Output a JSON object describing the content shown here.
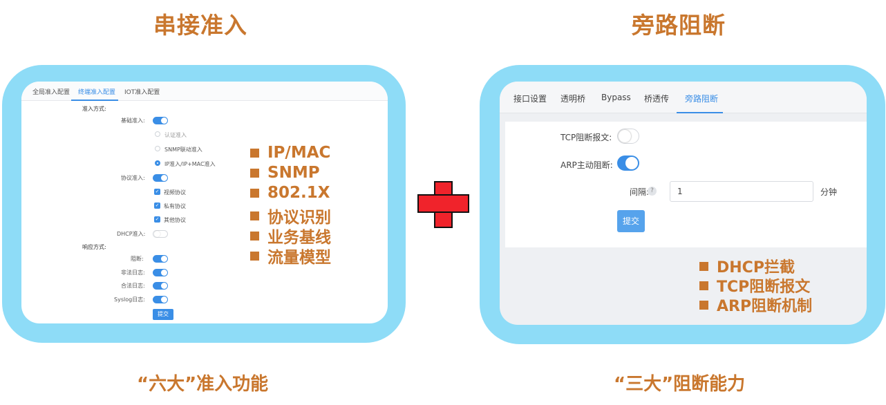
{
  "left": {
    "heading": "串接准入",
    "caption": "“六大”准入功能",
    "tabs": [
      "全局准入配置",
      "终端准入配置",
      "IOT准入配置"
    ],
    "form": {
      "access_mode_label": "准入方式:",
      "basic_access_label": "基础准入:",
      "radio_options": [
        "认证准入",
        "SNMP联动准入",
        "IP准入/IP+MAC准入"
      ],
      "protocol_access_label": "协议准入:",
      "checkbox_options": [
        "视频协议",
        "私有协议",
        "其他协议"
      ],
      "dhcp_access_label": "DHCP准入:",
      "response_mode_label": "响应方式:",
      "block_label": "阻断:",
      "illegal_log_label": "非法日志:",
      "legal_log_label": "合法日志:",
      "syslog_label": "Syslog日志:",
      "submit_label": "提交"
    },
    "features": [
      "IP/MAC",
      "SNMP",
      "802.1X",
      "协议识别",
      "业务基线",
      "流量模型"
    ]
  },
  "right": {
    "heading": "旁路阻断",
    "caption": "“三大”阻断能力",
    "tabs": [
      "接口设置",
      "透明桥",
      "Bypass",
      "桥透传",
      "旁路阻断"
    ],
    "form": {
      "tcp_block_label": "TCP阻断报文:",
      "arp_block_label": "ARP主动阻断:",
      "interval_label": "间隔:",
      "help_glyph": "?",
      "interval_value": "1",
      "interval_unit": "分钟",
      "submit_label": "提交"
    },
    "features": [
      "DHCP拦截",
      "TCP阻断报文",
      "ARP阻断机制"
    ]
  },
  "colors": {
    "accent_orange": "#c9772e",
    "frame_blue": "#8edcf7",
    "toggle_blue": "#3a8ee6",
    "plus_red": "#f0232b"
  }
}
